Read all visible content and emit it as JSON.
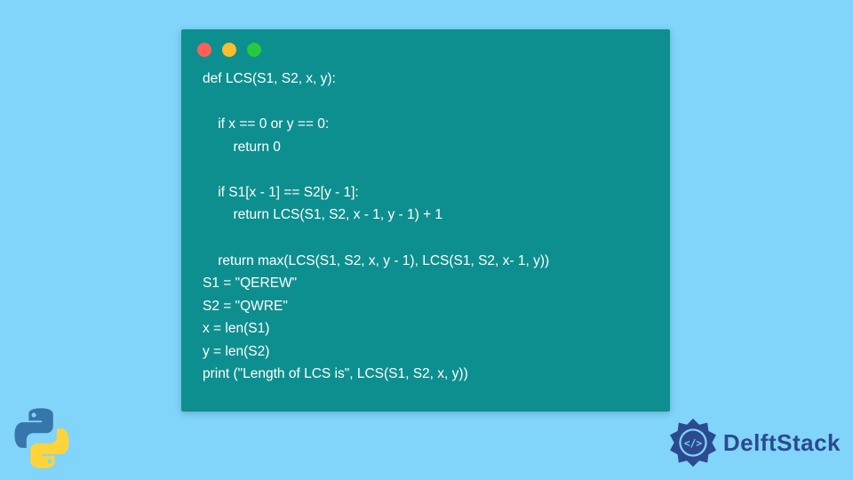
{
  "code": {
    "lines": "def LCS(S1, S2, x, y):\n\n    if x == 0 or y == 0:\n        return 0\n\n    if S1[x - 1] == S2[y - 1]:\n        return LCS(S1, S2, x - 1, y - 1) + 1\n\n    return max(LCS(S1, S2, x, y - 1), LCS(S1, S2, x- 1, y))\nS1 = \"QEREW\"\nS2 = \"QWRE\"\nx = len(S1)\ny = len(S2)\nprint (\"Length of LCS is\", LCS(S1, S2, x, y))"
  },
  "brand": {
    "name": "DelftStack"
  },
  "colors": {
    "page_bg": "#81d4fa",
    "window_bg": "#0e8f8f",
    "code_text": "#ffffff",
    "brand_text": "#2b4a8f"
  }
}
